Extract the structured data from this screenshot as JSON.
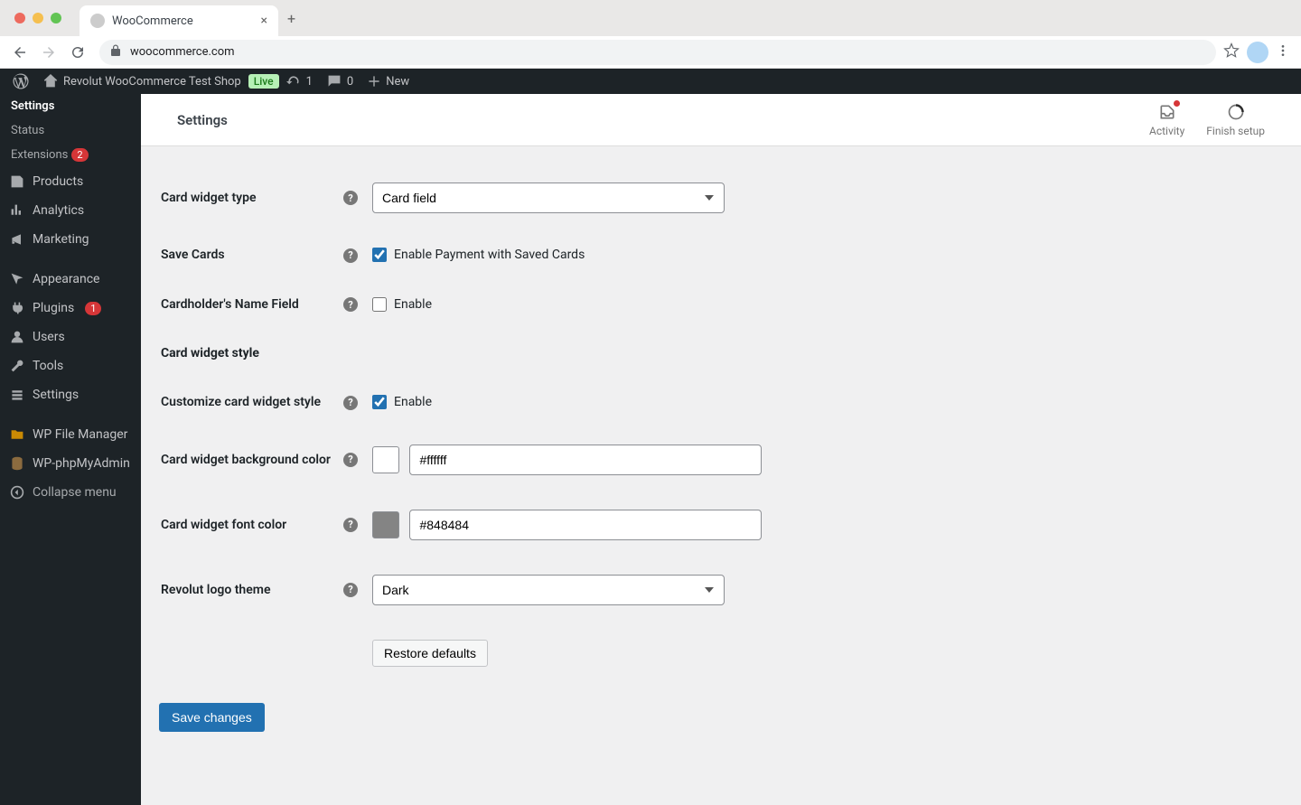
{
  "browser": {
    "tab_title": "WooCommerce",
    "url": "woocommerce.com"
  },
  "adminbar": {
    "site_name": "Revolut WooCommerce Test Shop",
    "live_label": "Live",
    "updates_count": "1",
    "comments_count": "0",
    "new_label": "New"
  },
  "sidebar": {
    "settings_label": "Settings",
    "status_label": "Status",
    "extensions_label": "Extensions",
    "extensions_badge": "2",
    "products_label": "Products",
    "analytics_label": "Analytics",
    "marketing_label": "Marketing",
    "appearance_label": "Appearance",
    "plugins_label": "Plugins",
    "plugins_badge": "1",
    "users_label": "Users",
    "tools_label": "Tools",
    "wp_settings_label": "Settings",
    "wpfile_label": "WP File Manager",
    "phpmyadmin_label": "WP-phpMyAdmin",
    "collapse_label": "Collapse menu"
  },
  "header": {
    "title": "Settings",
    "activity_label": "Activity",
    "finish_setup_label": "Finish setup"
  },
  "form": {
    "card_widget_type_label": "Card widget type",
    "card_widget_type_value": "Card field",
    "save_cards_label": "Save Cards",
    "save_cards_check_label": "Enable Payment with Saved Cards",
    "cardholder_name_label": "Cardholder's Name Field",
    "enable_label": "Enable",
    "card_widget_style_title": "Card widget style",
    "customize_style_label": "Customize card widget style",
    "bg_color_label": "Card widget background color",
    "bg_color_value": "#ffffff",
    "font_color_label": "Card widget font color",
    "font_color_value": "#848484",
    "logo_theme_label": "Revolut logo theme",
    "logo_theme_value": "Dark",
    "restore_label": "Restore defaults",
    "save_label": "Save changes"
  }
}
